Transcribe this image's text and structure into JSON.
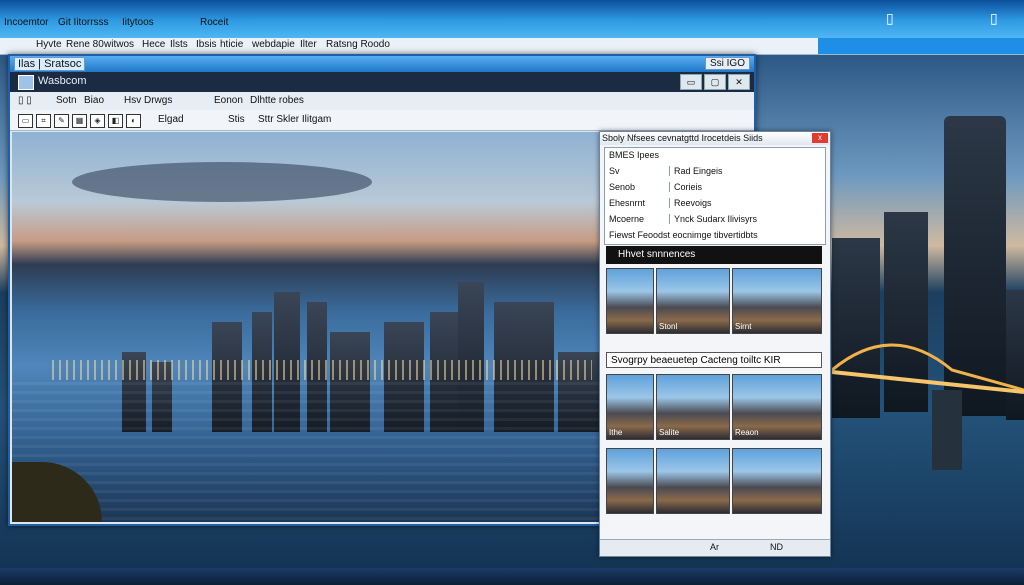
{
  "outer": {
    "menu": [
      "Incoemtor",
      "Git Iitorrsss",
      "Iitytoos",
      "Roceit"
    ],
    "menu2": [
      "Hyvte",
      "Rene 80",
      "witwos",
      "Hece",
      "Ilsts",
      "Ibsis",
      "hticie",
      "webdapie",
      "Ilter",
      "Ratsng Roodo"
    ],
    "right_icon_1": "▯",
    "right_icon_2": "▯"
  },
  "window": {
    "title_left": "Ilas | Sratsoc",
    "title_right": "Ssi IGO",
    "header_label": "Wasbcom",
    "menu": [
      "Sotn",
      "Biao",
      "Hsv Drwgs",
      "Eonon",
      "Dlhtte robes"
    ],
    "toolbar_labels": [
      "Elgad",
      "Stis",
      "Sttr Skler Ilitgam"
    ]
  },
  "dialog": {
    "title": "Sboly Nfsees cevnatgttd Irocetdeis Siids",
    "close": "x",
    "section1_label": "BMES Ipees",
    "rows": [
      {
        "key": "Sv",
        "value": "Rad Eingeis"
      },
      {
        "key": "Senob",
        "value": "Corieis"
      },
      {
        "key": "Ehesnrnt",
        "value": "Reevoigs"
      },
      {
        "key": "Mcoerne",
        "value": "Ynck Sudarx Ilivisyrs"
      }
    ],
    "row_footer": "Fiewst Feoodst eocnimge tibvertidbts",
    "section_a": "Hhvet snnnences",
    "section_b": "Svogrpy beaeuetep Cacteng toiltc KIR",
    "captions_a": [
      "",
      "Stonl",
      "Sirnt"
    ],
    "captions_b": [
      "Ithe",
      "Salite",
      "Reaon"
    ],
    "footer_left": "Ar",
    "footer_right": "ND"
  }
}
